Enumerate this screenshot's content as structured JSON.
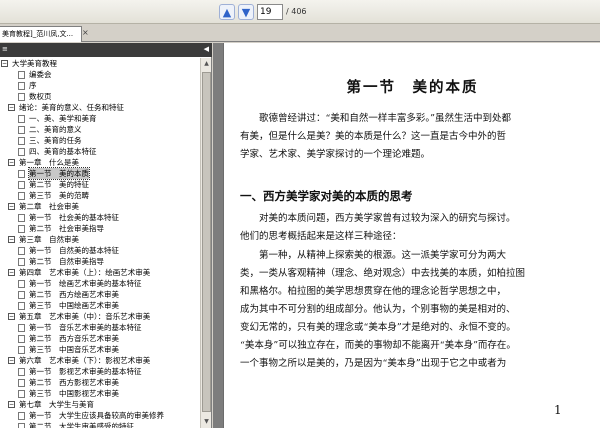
{
  "toolbar": {
    "page_current": "19",
    "page_total": "/ 406"
  },
  "tab": {
    "title": "美育教程]_范川凤,文...",
    "close_glyph": "×"
  },
  "toc": [
    {
      "label": "大学美育教程",
      "box": "−",
      "kind": "root"
    },
    {
      "label": "编委会",
      "kind": "doc"
    },
    {
      "label": "序",
      "kind": "doc"
    },
    {
      "label": "数权页",
      "kind": "doc"
    },
    {
      "label": "绪论：美育的意义、任务和特征",
      "box": "−",
      "kind": "folder"
    },
    {
      "label": "一、美、美学和美育",
      "kind": "doc"
    },
    {
      "label": "二、美育的意义",
      "kind": "doc"
    },
    {
      "label": "三、美育的任务",
      "kind": "doc"
    },
    {
      "label": "四、美育的基本特征",
      "kind": "doc"
    },
    {
      "label": "第一章　什么是美",
      "box": "−",
      "kind": "folder"
    },
    {
      "label": "第一节　美的本质",
      "kind": "doc",
      "selected": true
    },
    {
      "label": "第二节　美的特征",
      "kind": "doc"
    },
    {
      "label": "第三节　美的范畴",
      "kind": "doc"
    },
    {
      "label": "第二章　社会审美",
      "box": "−",
      "kind": "folder"
    },
    {
      "label": "第一节　社会美的基本特征",
      "kind": "doc"
    },
    {
      "label": "第二节　社会审美指导",
      "kind": "doc"
    },
    {
      "label": "第三章　自然审美",
      "box": "−",
      "kind": "folder"
    },
    {
      "label": "第一节　自然美的基本特征",
      "kind": "doc"
    },
    {
      "label": "第二节　自然审美指导",
      "kind": "doc"
    },
    {
      "label": "第四章　艺术审美（上）：绘画艺术审美",
      "box": "−",
      "kind": "folder"
    },
    {
      "label": "第一节　绘画艺术审美的基本特征",
      "kind": "doc"
    },
    {
      "label": "第二节　西方绘画艺术审美",
      "kind": "doc"
    },
    {
      "label": "第三节　中国绘画艺术审美",
      "kind": "doc"
    },
    {
      "label": "第五章　艺术审美（中）：音乐艺术审美",
      "box": "−",
      "kind": "folder"
    },
    {
      "label": "第一节　音乐艺术审美的基本特征",
      "kind": "doc"
    },
    {
      "label": "第二节　西方音乐艺术审美",
      "kind": "doc"
    },
    {
      "label": "第三节　中国音乐艺术审美",
      "kind": "doc"
    },
    {
      "label": "第六章　艺术审美（下）：影视艺术审美",
      "box": "−",
      "kind": "folder"
    },
    {
      "label": "第一节　影视艺术审美的基本特征",
      "kind": "doc"
    },
    {
      "label": "第二节　西方影视艺术审美",
      "kind": "doc"
    },
    {
      "label": "第三节　中国影视艺术审美",
      "kind": "doc"
    },
    {
      "label": "第七章　大学生与美育",
      "box": "−",
      "kind": "folder"
    },
    {
      "label": "第一节　大学生应该具备较高的审美修养",
      "kind": "doc"
    },
    {
      "label": "第二节　大学生审美感受的特征",
      "kind": "doc"
    }
  ],
  "document": {
    "title": "第一节　美的本质",
    "para1": [
      "歌德曾经讲过：“美和自然一样丰富多彩。”虽然生活中到处都",
      "有美，但是什么是美？美的本质是什么？这一直是古今中外的哲",
      "学家、艺术家、美学家探讨的一个理论难题。"
    ],
    "section_heading": "一、西方美学家对美的本质的思考",
    "para2": [
      "对美的本质问题，西方美学家曾有过较为深入的研究与探讨。",
      "他们的思考概括起来是这样三种途径："
    ],
    "para3": [
      "第一种，从精神上探索美的根源。这一派美学家可分为两大",
      "类，一类从客观精神（理念、绝对观念）中去找美的本质，如柏拉图",
      "和黑格尔。柏拉图的美学思想贯穿在他的理念论哲学思想之中，",
      "成为其中不可分割的组成部分。他认为，个别事物的美是相对的、",
      "变幻无常的，只有美的理念或“美本身”才是绝对的、永恒不变的。",
      "“美本身”可以独立存在，而美的事物却不能离开“美本身”而存在。",
      "一个事物之所以是美的，乃是因为“美本身”出现于它之中或者为"
    ],
    "page_number": "1"
  }
}
